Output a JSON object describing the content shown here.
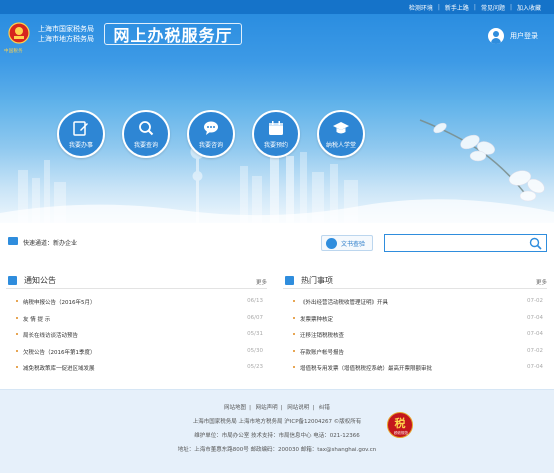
{
  "topbar": {
    "links": [
      "检测环境",
      "新手上路",
      "常见问题",
      "加入收藏"
    ]
  },
  "header": {
    "org_line1": "上海市国家税务局",
    "org_line2": "上海市地方税务局",
    "site_title": "网上办税服务厅",
    "logo_mark": "中国税务",
    "login_label": "用户登录"
  },
  "tiles": [
    {
      "label": "我要办事",
      "icon": "edit-icon"
    },
    {
      "label": "我要查询",
      "icon": "search-icon"
    },
    {
      "label": "我要咨询",
      "icon": "chat-icon"
    },
    {
      "label": "我要预约",
      "icon": "calendar-icon"
    },
    {
      "label": "纳税人学堂",
      "icon": "graduation-cap-icon"
    }
  ],
  "quick": {
    "label": "快速通道：",
    "value": "新办企业",
    "text_search_label": "文书查验",
    "search_placeholder": ""
  },
  "notice": {
    "title": "通知公告",
    "more": "更多",
    "items": [
      {
        "title": "纳税申报公告（2016年5月）",
        "date": "06/13"
      },
      {
        "title": "友 情 提 示",
        "date": "06/07"
      },
      {
        "title": "局长在线访谈活动预告",
        "date": "05/31"
      },
      {
        "title": "欠税公告（2016年第1季度）",
        "date": "05/30"
      },
      {
        "title": "减免税政策库一促进区域发展",
        "date": "05/23"
      }
    ]
  },
  "hot": {
    "title": "热门事项",
    "more": "更多",
    "items": [
      {
        "title": "《外出经营活动税收管理证明》开具",
        "date": "07-02"
      },
      {
        "title": "发票票种核定",
        "date": "07-04"
      },
      {
        "title": "迁移注销税税核查",
        "date": "07-04"
      },
      {
        "title": "存款账户帐号报告",
        "date": "07-02"
      },
      {
        "title": "增值税专用发票（增值税税控系统）最高开票限额审批",
        "date": "07-04"
      }
    ]
  },
  "footer": {
    "links": [
      "网站地图",
      "网站声明",
      "网站说明",
      "纠错"
    ],
    "line1": "上海市国家税务局 上海市地方税务局 沪ICP备12004267 ©版权所有",
    "line2": "维护单位：市局办公室  技术支持：市局信息中心 电话：021-12366",
    "line3": "地址：上海市董惠东路800号  邮政编码：200030  邮箱：tax@shanghai.gov.cn",
    "badge_text": "税",
    "badge_caption": "税收规范"
  },
  "colors": {
    "primary": "#1573c9",
    "tile": "#2e86d4",
    "accent": "#e08a1e",
    "footer_bg": "#e6f0fa"
  }
}
